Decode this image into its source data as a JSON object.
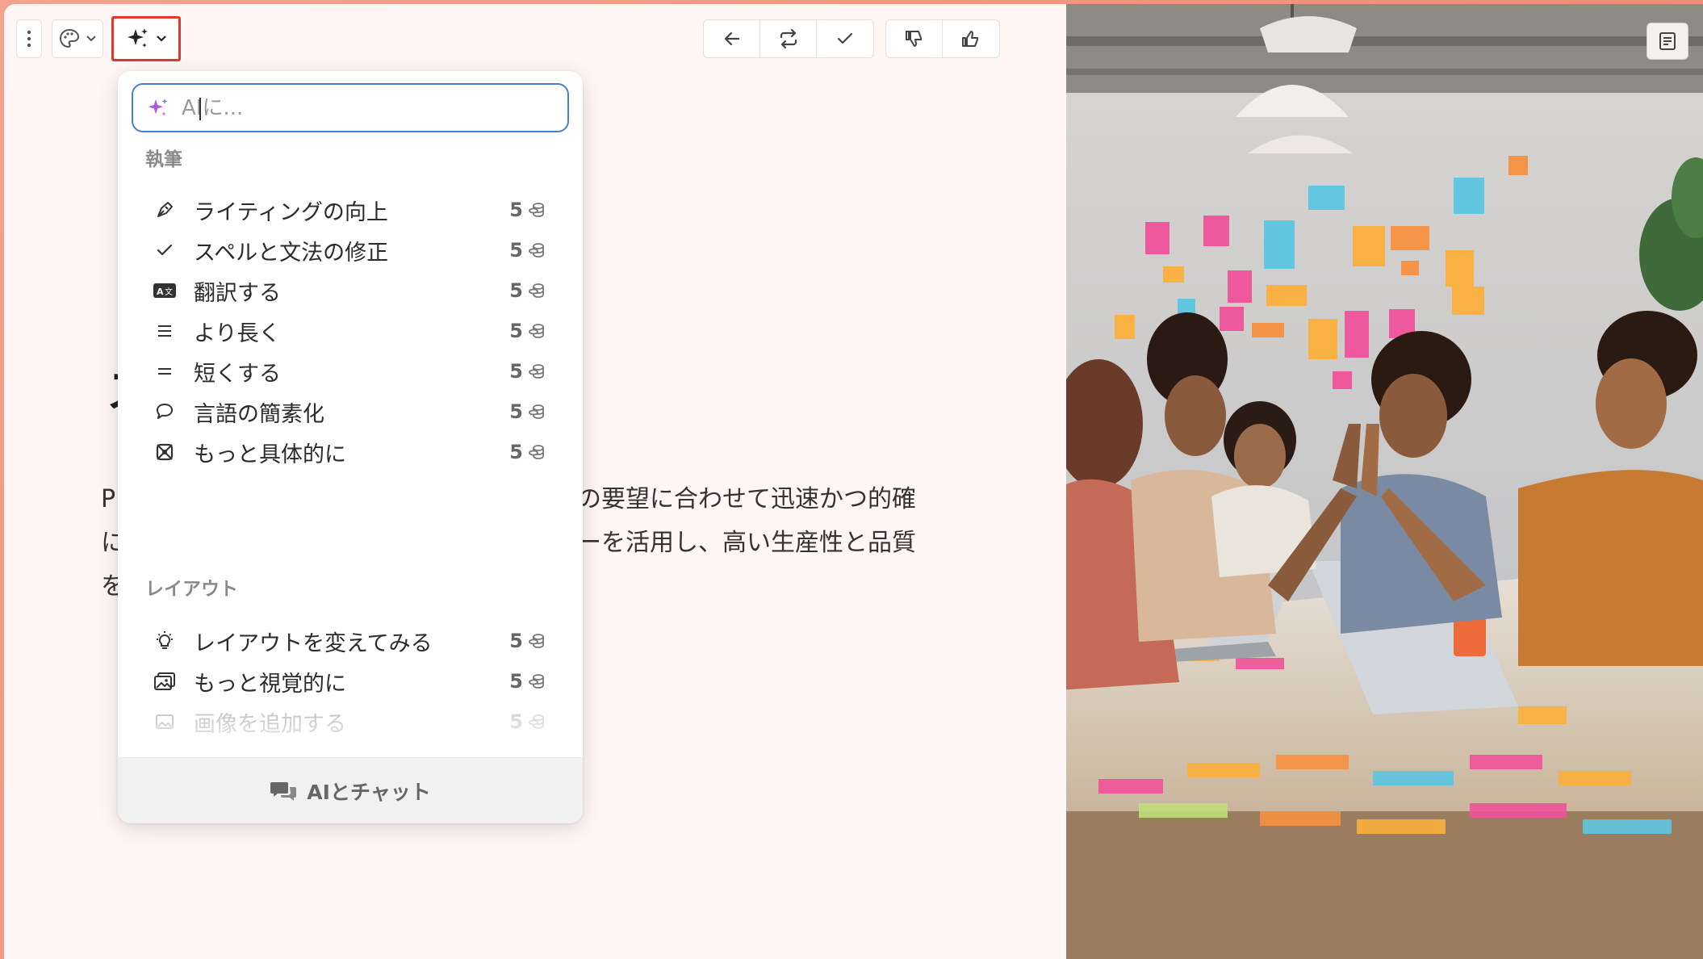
{
  "toolbar": {
    "more_icon": "vertical-dots-icon",
    "theme_icon": "palette-icon",
    "ai_icon": "sparkles-icon",
    "actions": [
      {
        "name": "back-button",
        "icon": "arrow-left-icon"
      },
      {
        "name": "regenerate-button",
        "icon": "repeat-icon"
      },
      {
        "name": "accept-button",
        "icon": "check-icon"
      }
    ],
    "feedback": [
      {
        "name": "thumbs-down-button",
        "icon": "thumbs-down-icon"
      },
      {
        "name": "thumbs-up-button",
        "icon": "thumbs-up-icon"
      }
    ],
    "highlight_color": "#e0392b"
  },
  "ai_menu": {
    "input_placeholder": "AIに...",
    "sections": {
      "writing": "執筆",
      "layout": "レイアウト"
    },
    "writing_items": [
      {
        "label": "ライティングの向上",
        "cost": "5",
        "icon": "pen-nib-icon"
      },
      {
        "label": "スペルと文法の修正",
        "cost": "5",
        "icon": "check-icon"
      },
      {
        "label": "翻訳する",
        "cost": "5",
        "icon": "translate-icon"
      },
      {
        "label": "より長く",
        "cost": "5",
        "icon": "lines-icon"
      },
      {
        "label": "短くする",
        "cost": "5",
        "icon": "short-lines-icon"
      },
      {
        "label": "言語の簡素化",
        "cost": "5",
        "icon": "speech-bubble-icon"
      },
      {
        "label": "もっと具体的に",
        "cost": "5",
        "icon": "target-icon"
      }
    ],
    "layout_items": [
      {
        "label": "レイアウトを変えてみる",
        "cost": "5",
        "icon": "lightbulb-icon"
      },
      {
        "label": "もっと視覚的に",
        "cost": "5",
        "icon": "image-icon"
      },
      {
        "label": "画像を追加する",
        "cost": "5",
        "icon": "add-image-icon"
      }
    ],
    "footer_label": "AIとチャット",
    "accent_color": "#4a7fd0",
    "sparkle_color": "#b05cd6"
  },
  "document": {
    "para_line1_left": "P",
    "para_line1_right": "の要望に合わせて迅速かつ的確",
    "para_line2_left": "に",
    "para_line2_right": "ーを活用し、高い生産性と品質",
    "para_line3_left": "を"
  },
  "side_panel": {
    "image_description": "team-high-five-photo",
    "notes_icon": "notes-icon"
  }
}
